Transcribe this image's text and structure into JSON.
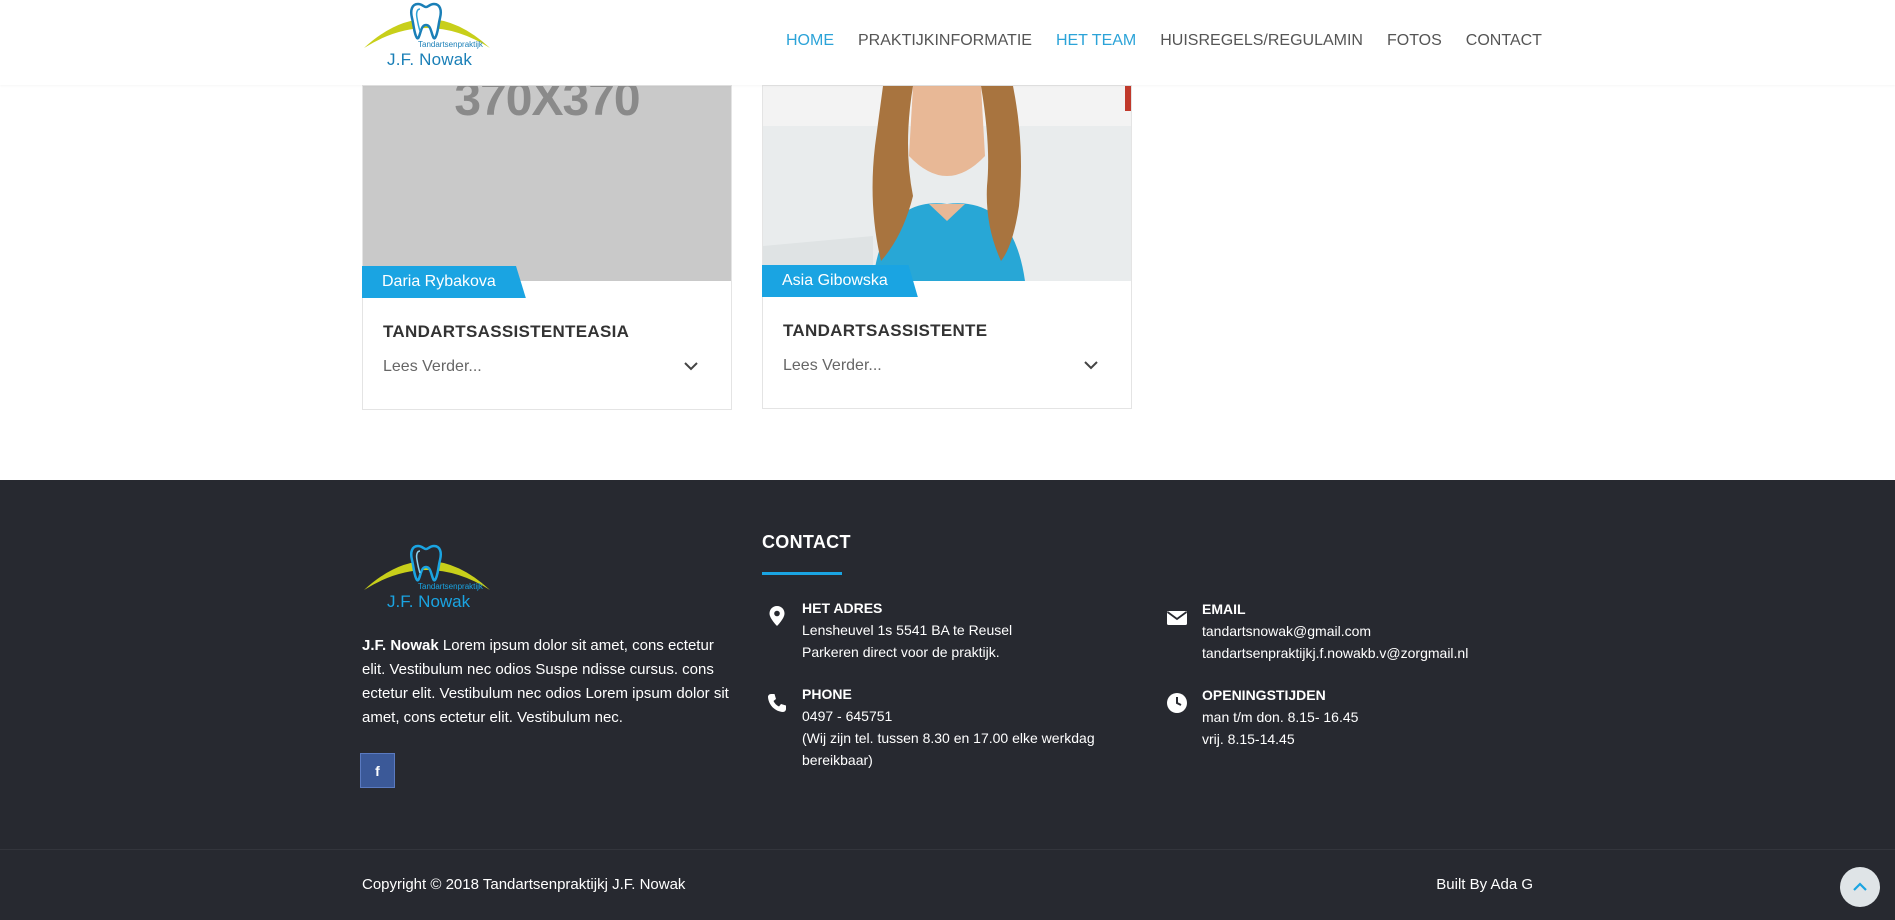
{
  "header": {
    "logo": {
      "small_text": "Tandartsenpraktijk",
      "name": "J.F. Nowak"
    },
    "nav": [
      {
        "label": "HOME",
        "active": true
      },
      {
        "label": "PRAKTIJKINFORMATIE",
        "active": false
      },
      {
        "label": "HET TEAM",
        "active": true
      },
      {
        "label": "HUISREGELS/REGULAMIN",
        "active": false
      },
      {
        "label": "FOTOS",
        "active": false
      },
      {
        "label": "CONTACT",
        "active": false
      }
    ]
  },
  "team": [
    {
      "photo_text": "370X370",
      "name": "Daria Rybakova",
      "role": "TANDARTSASSISTENTEASIA",
      "read_more": "Lees Verder..."
    },
    {
      "photo_text": "",
      "name": "Asia Gibowska",
      "role": "TANDARTSASSISTENTE",
      "read_more": "Lees Verder..."
    }
  ],
  "footer": {
    "logo": {
      "small_text": "Tandartsenpraktijk",
      "name": "J.F. Nowak"
    },
    "about_name": "J.F. Nowak",
    "about_text": " Lorem ipsum dolor sit amet, cons ectetur elit. Vestibulum nec odios Suspe ndisse cursus. cons ectetur elit. Vestibulum nec odios Lorem ipsum dolor sit amet, cons ectetur elit. Vestibulum nec.",
    "social": {
      "facebook": "f"
    },
    "contact_title": "CONTACT",
    "address": {
      "label": "HET ADRES",
      "line1": "Lensheuvel 1s 5541 BA te Reusel",
      "line2": "Parkeren direct voor de praktijk."
    },
    "phone": {
      "label": "PHONE",
      "line1": "0497 - 645751",
      "line2": "(Wij zijn tel. tussen 8.30 en 17.00 elke werkdag",
      "line3": "bereikbaar)"
    },
    "email": {
      "label": "EMAIL",
      "line1": "tandartsnowak@gmail.com",
      "line2": "tandartsenpraktijkj.f.nowakb.v@zorgmail.nl"
    },
    "hours": {
      "label": "OPENINGSTIJDEN",
      "line1": "man t/m don. 8.15- 16.45",
      "line2": "vrij. 8.15-14.45"
    },
    "copyright": "Copyright © 2018 Tandartsenpraktijkj J.F. Nowak",
    "built_by": "Built By Ada G"
  },
  "colors": {
    "accent": "#1aa4e2",
    "footer_bg": "#272930",
    "nav_active": "#2ba3d8",
    "facebook": "#3b5998"
  }
}
